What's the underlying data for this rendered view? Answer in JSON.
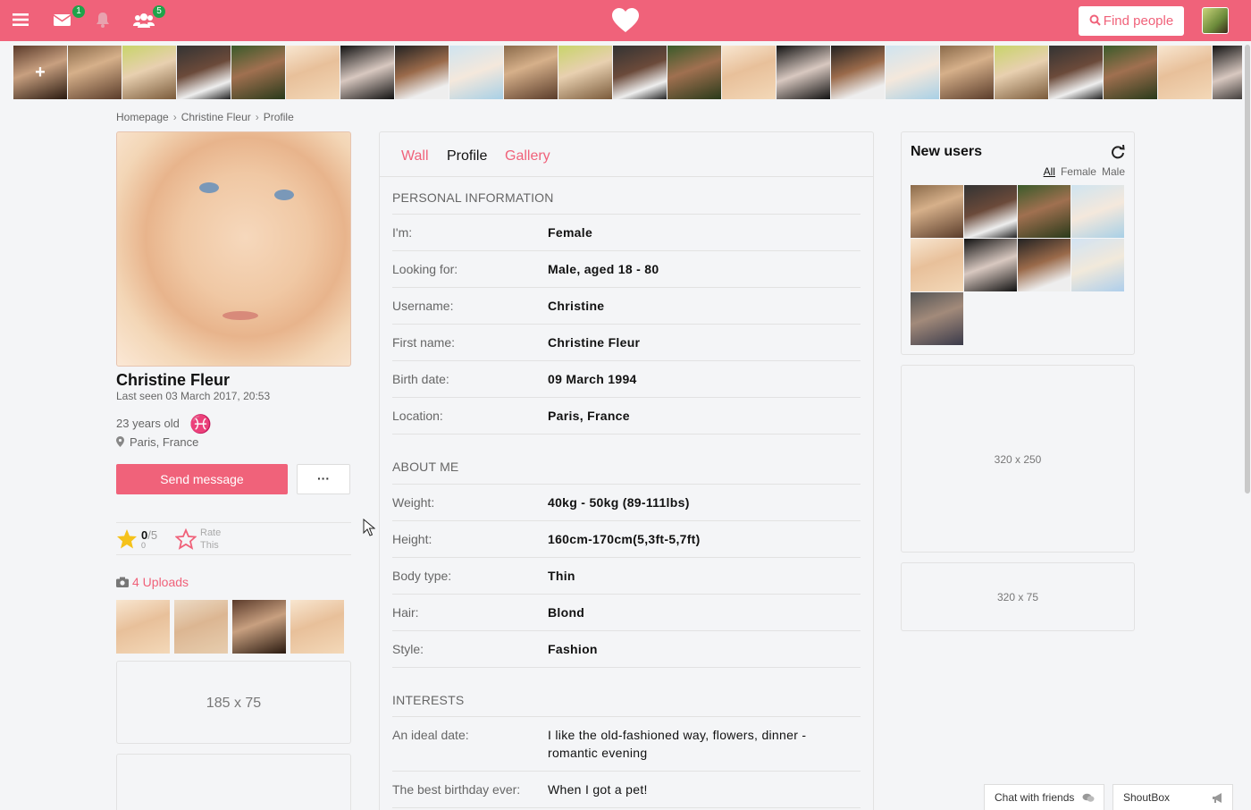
{
  "header": {
    "messages_badge": "1",
    "friends_badge": "5",
    "find_people_label": "Find people"
  },
  "breadcrumb": {
    "items": [
      "Homepage",
      "Christine Fleur",
      "Profile"
    ]
  },
  "profile": {
    "name": "Christine Fleur",
    "last_seen": "Last seen 03 March 2017, 20:53",
    "age": "23 years old",
    "zodiac_symbol": "♓",
    "location": "Paris, France",
    "send_message_label": "Send message",
    "more_label": "···",
    "rating_score": "0",
    "rating_of": "/5",
    "rating_votes": "0",
    "rate_label_1": "Rate",
    "rate_label_2": "This",
    "uploads_label": "4 Uploads",
    "ad_left": "185 x 75"
  },
  "tabs": {
    "wall": "Wall",
    "profile": "Profile",
    "gallery": "Gallery"
  },
  "personal": {
    "title": "PERSONAL INFORMATION",
    "rows": [
      {
        "label": "I'm:",
        "value": "Female"
      },
      {
        "label": "Looking for:",
        "value": "Male, aged 18 - 80"
      },
      {
        "label": "Username:",
        "value": "Christine"
      },
      {
        "label": "First name:",
        "value": "Christine Fleur"
      },
      {
        "label": "Birth date:",
        "value": "09 March 1994"
      },
      {
        "label": "Location:",
        "value": "Paris, France"
      }
    ]
  },
  "about": {
    "title": "ABOUT ME",
    "rows": [
      {
        "label": "Weight:",
        "value": "40kg - 50kg (89-111lbs)"
      },
      {
        "label": "Height:",
        "value": "160cm-170cm(5,3ft-5,7ft)"
      },
      {
        "label": "Body type:",
        "value": "Thin"
      },
      {
        "label": "Hair:",
        "value": "Blond"
      },
      {
        "label": "Style:",
        "value": "Fashion"
      }
    ]
  },
  "interests": {
    "title": "INTERESTS",
    "rows": [
      {
        "label": "An ideal date:",
        "value": "I like the old-fashioned way, flowers, dinner - romantic evening"
      },
      {
        "label": "The best birthday ever:",
        "value": "When I got a pet!"
      }
    ]
  },
  "new_users": {
    "title": "New users",
    "filters": [
      "All",
      "Female",
      "Male"
    ],
    "ad_large": "320 x 250",
    "ad_small": "320 x 75"
  },
  "chat": {
    "friends_label": "Chat with friends",
    "shoutbox_label": "ShoutBox"
  },
  "colors": {
    "brand": "#f0627a",
    "badge": "#1fa34a"
  }
}
